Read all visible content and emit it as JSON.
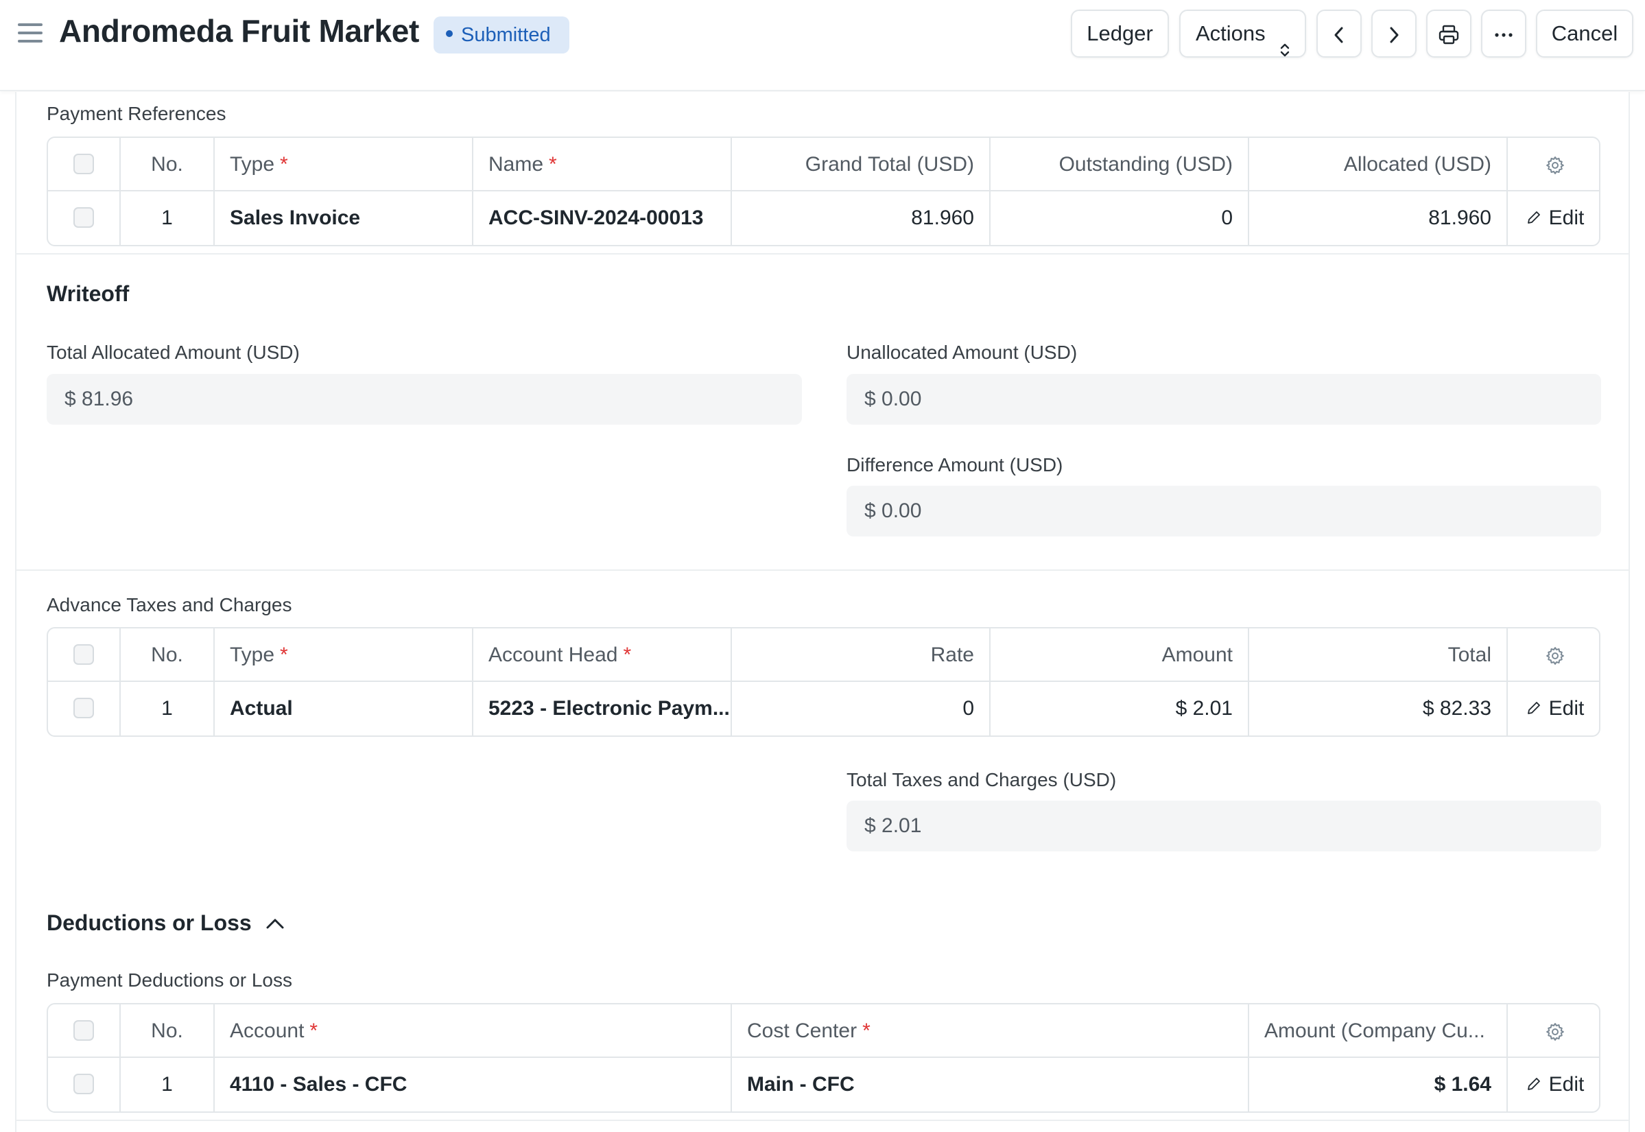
{
  "header": {
    "title": "Andromeda Fruit Market",
    "status": "Submitted",
    "ledger_label": "Ledger",
    "actions_label": "Actions",
    "cancel_label": "Cancel"
  },
  "payment_references": {
    "label": "Payment References",
    "columns": [
      "No.",
      "Type",
      "Name",
      "Grand Total (USD)",
      "Outstanding (USD)",
      "Allocated (USD)"
    ],
    "rows": [
      {
        "no": "1",
        "type": "Sales Invoice",
        "name": "ACC-SINV-2024-00013",
        "grand_total": "81.960",
        "outstanding": "0",
        "allocated": "81.960",
        "edit": "Edit"
      }
    ]
  },
  "writeoff": {
    "title": "Writeoff",
    "total_allocated_label": "Total Allocated Amount (USD)",
    "total_allocated_value": "$ 81.96",
    "unallocated_label": "Unallocated Amount (USD)",
    "unallocated_value": "$ 0.00",
    "difference_label": "Difference Amount (USD)",
    "difference_value": "$ 0.00"
  },
  "advance_taxes": {
    "label": "Advance Taxes and Charges",
    "columns": [
      "No.",
      "Type",
      "Account Head",
      "Rate",
      "Amount",
      "Total"
    ],
    "rows": [
      {
        "no": "1",
        "type": "Actual",
        "account_head": "5223 - Electronic Paym...",
        "rate": "0",
        "amount": "$ 2.01",
        "total": "$ 82.33",
        "edit": "Edit"
      }
    ],
    "total_label": "Total Taxes and Charges (USD)",
    "total_value": "$ 2.01"
  },
  "deductions": {
    "title": "Deductions or Loss",
    "label": "Payment Deductions or Loss",
    "columns": [
      "No.",
      "Account",
      "Cost Center",
      "Amount (Company Cu..."
    ],
    "rows": [
      {
        "no": "1",
        "account": "4110 - Sales - CFC",
        "cost_center": "Main - CFC",
        "amount": "$ 1.64",
        "edit": "Edit"
      }
    ]
  },
  "colors": {
    "badge_bg": "#dde9f8",
    "badge_text": "#1c5fb8",
    "required": "#e03636",
    "input_bg": "#f4f5f6"
  },
  "icons": [
    "menu-icon",
    "updown-icon",
    "chevron-left-icon",
    "chevron-right-icon",
    "printer-icon",
    "more-icon",
    "gear-icon",
    "pencil-icon",
    "chevron-up-icon"
  ]
}
